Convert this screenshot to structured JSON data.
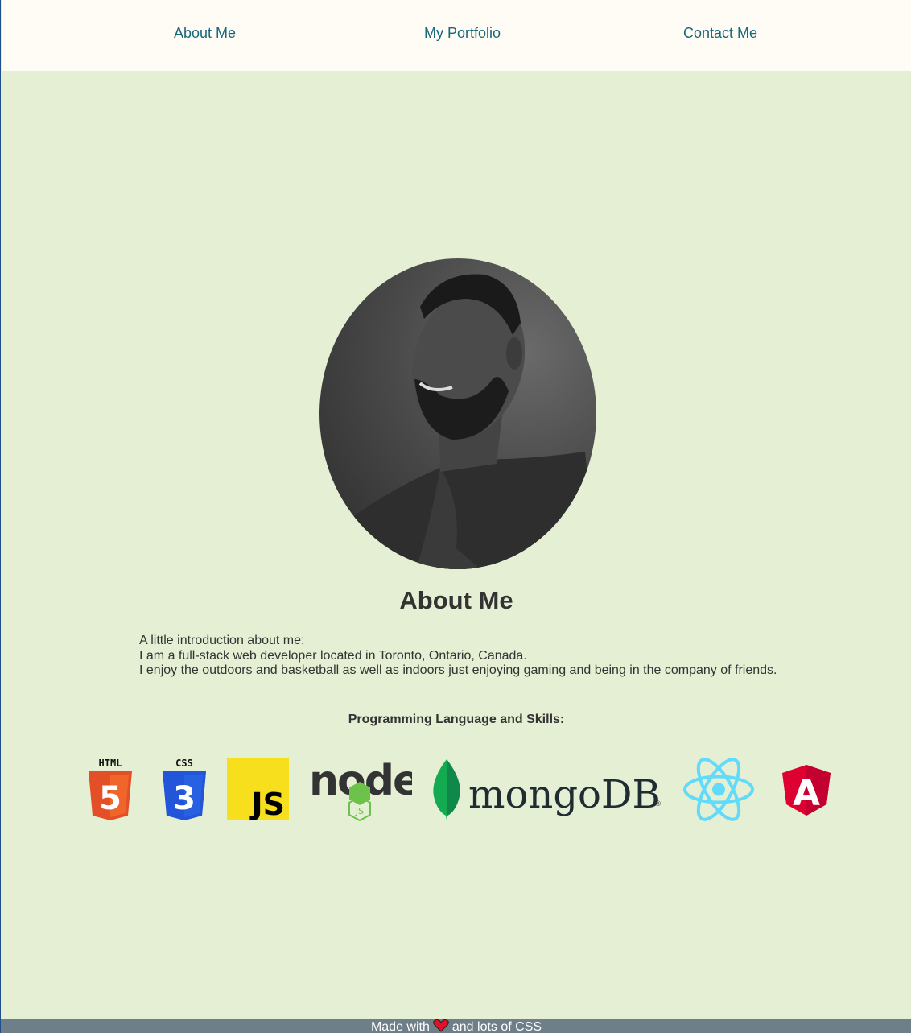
{
  "nav": {
    "items": [
      {
        "label": "About Me"
      },
      {
        "label": "My Portfolio"
      },
      {
        "label": "Contact Me"
      }
    ]
  },
  "profile": {
    "heading": "About Me",
    "intro_lines": [
      "A little introduction about me:",
      "I am a full-stack web developer located in Toronto, Ontario, Canada.",
      "I enjoy the outdoors and basketball as well as indoors just enjoying gaming and being in the company of friends."
    ]
  },
  "skills": {
    "title": "Programming Language and Skills:",
    "logos": [
      {
        "name": "html5-logo",
        "label": "HTML",
        "glyph": "5"
      },
      {
        "name": "css3-logo",
        "label": "CSS",
        "glyph": "3"
      },
      {
        "name": "javascript-logo",
        "label": "JS"
      },
      {
        "name": "nodejs-logo",
        "label": "node",
        "sub": "JS"
      },
      {
        "name": "mongodb-logo",
        "label": "mongoDB"
      },
      {
        "name": "react-logo"
      },
      {
        "name": "angular-logo",
        "label": "A"
      }
    ]
  },
  "footer": {
    "before": "Made with",
    "after": "and lots of CSS"
  },
  "colors": {
    "background": "#e5efd4",
    "navbar": "#fffcf6",
    "nav_link": "#17687a",
    "footer": "#6e7f8a"
  }
}
